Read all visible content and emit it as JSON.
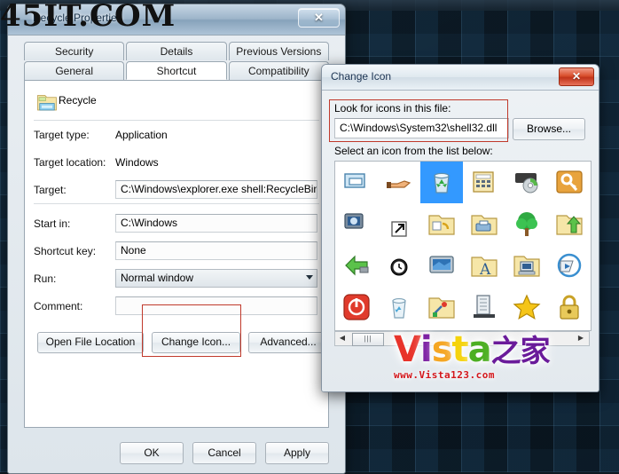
{
  "watermarks": {
    "top_text": "45IT.COM",
    "logo_word": [
      "V",
      "i",
      "s",
      "t",
      "a",
      "之家"
    ],
    "logo_url": "www.Vista123.com"
  },
  "properties_window": {
    "title": "Recycle Properties",
    "close_label": "✕",
    "tabs_row1": [
      {
        "label": "Security",
        "active": false
      },
      {
        "label": "Details",
        "active": false
      },
      {
        "label": "Previous Versions",
        "active": false
      }
    ],
    "tabs_row2": [
      {
        "label": "General",
        "active": false
      },
      {
        "label": "Shortcut",
        "active": true
      },
      {
        "label": "Compatibility",
        "active": false
      }
    ],
    "header": {
      "icon": "folder-recycle-icon",
      "label": "Recycle"
    },
    "fields": [
      {
        "label": "Target type:",
        "value": "Application",
        "kind": "text"
      },
      {
        "label": "Target location:",
        "value": "Windows",
        "kind": "text"
      },
      {
        "label": "Target:",
        "value": "C:\\Windows\\explorer.exe shell:RecycleBinFolder",
        "kind": "input"
      },
      {
        "label": "Start in:",
        "value": "C:\\Windows",
        "kind": "input"
      },
      {
        "label": "Shortcut key:",
        "value": "None",
        "kind": "input"
      },
      {
        "label": "Run:",
        "value": "Normal window",
        "kind": "combo"
      },
      {
        "label": "Comment:",
        "value": "",
        "kind": "input"
      }
    ],
    "action_buttons": [
      {
        "label": "Open File Location"
      },
      {
        "label": "Change Icon..."
      },
      {
        "label": "Advanced..."
      }
    ],
    "footer_buttons": [
      {
        "label": "OK"
      },
      {
        "label": "Cancel"
      },
      {
        "label": "Apply"
      }
    ]
  },
  "change_icon_window": {
    "title": "Change Icon",
    "close_label": "✕",
    "look_label": "Look for icons in this file:",
    "path_value": "C:\\Windows\\System32\\shell32.dll",
    "browse_label": "Browse...",
    "select_label": "Select an icon from the list below:",
    "scrollbar": {
      "left_arrow": "◀",
      "right_arrow": "▶",
      "thumb_label": "|||"
    },
    "icon_grid": [
      [
        {
          "name": "window-stack-icon",
          "selected": false
        },
        {
          "name": "hand-pointer-icon",
          "selected": false
        },
        {
          "name": "recycle-bin-icon",
          "selected": true
        },
        {
          "name": "calculator-panel-icon",
          "selected": false
        },
        {
          "name": "cd-drive-icon",
          "selected": false
        },
        {
          "name": "key-icon",
          "selected": false
        },
        {
          "name": "network-computer-icon",
          "selected": false
        }
      ],
      [
        {
          "name": "monitor-globe-icon",
          "selected": false
        },
        {
          "name": "shortcut-arrow-icon",
          "selected": false
        },
        {
          "name": "folder-settings-icon",
          "selected": false
        },
        {
          "name": "folder-printer-icon",
          "selected": false
        },
        {
          "name": "tree-icon",
          "selected": false
        },
        {
          "name": "folder-open-arrow-icon",
          "selected": false
        },
        {
          "name": "document-icon",
          "selected": false
        }
      ],
      [
        {
          "name": "usb-back-arrow-icon",
          "selected": false
        },
        {
          "name": "clock-icon",
          "selected": false
        },
        {
          "name": "desktop-screen-icon",
          "selected": false
        },
        {
          "name": "folder-fonts-icon",
          "selected": false
        },
        {
          "name": "folder-computer-icon",
          "selected": false
        },
        {
          "name": "media-center-icon",
          "selected": false
        },
        {
          "name": "page-icon",
          "selected": false
        }
      ],
      [
        {
          "name": "power-button-icon",
          "selected": false
        },
        {
          "name": "recycle-bin-empty-icon",
          "selected": false
        },
        {
          "name": "folder-tools-icon",
          "selected": false
        },
        {
          "name": "server-icon",
          "selected": false
        },
        {
          "name": "star-favorites-icon",
          "selected": false
        },
        {
          "name": "padlock-icon",
          "selected": false
        },
        {
          "name": "pen-icon",
          "selected": false
        }
      ]
    ]
  },
  "colors": {
    "annotation": "#c0392b",
    "selection": "#3399ff",
    "close_red": "#d94f2c"
  }
}
